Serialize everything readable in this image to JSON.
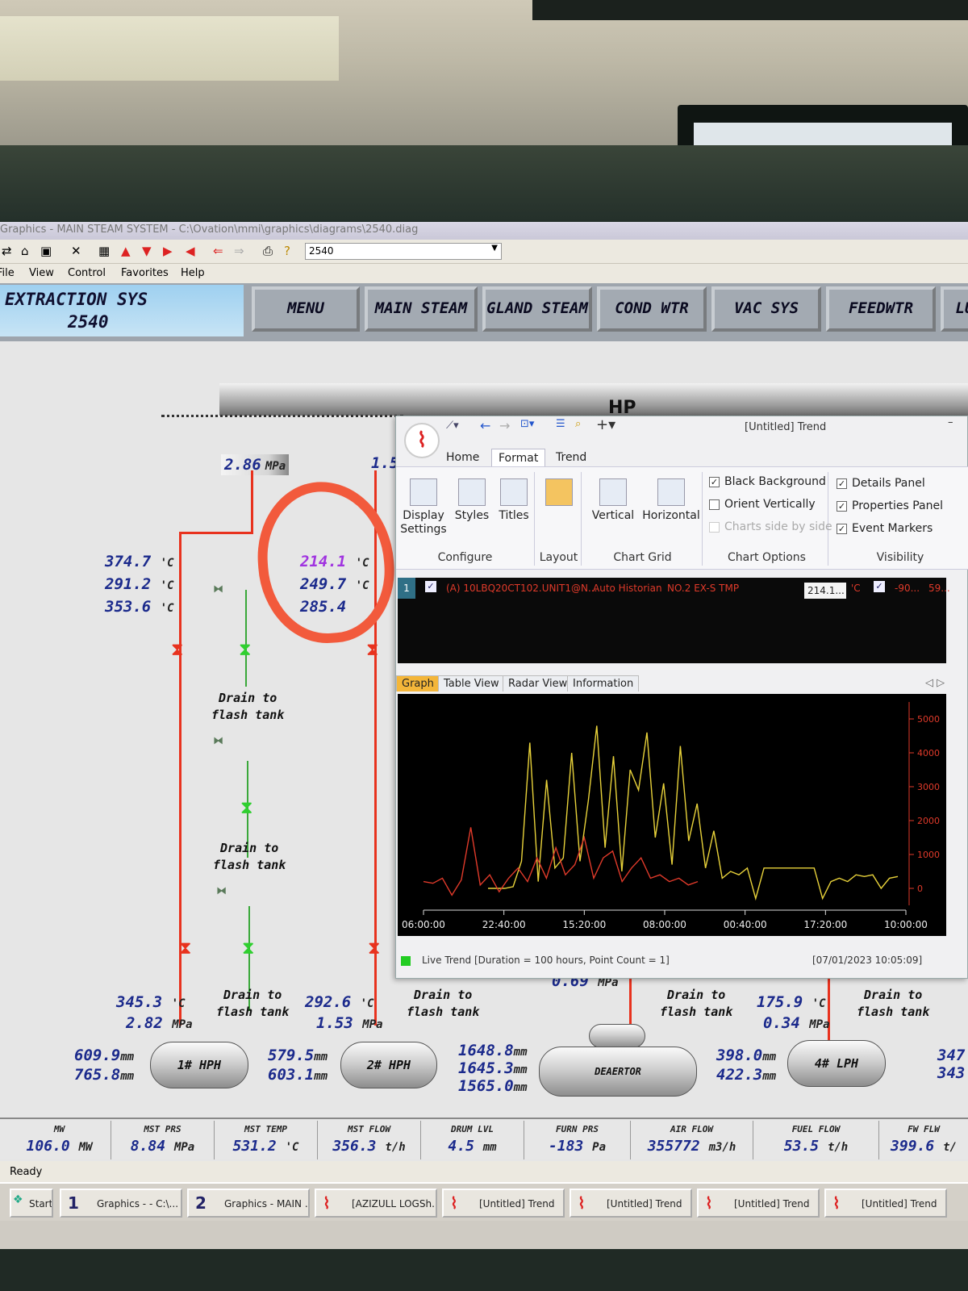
{
  "window": {
    "title": "Graphics - MAIN STEAM SYSTEM - C:\\Ovation\\mmi\\graphics\\diagrams\\2540.diag",
    "diagram_combo": "2540"
  },
  "menu": [
    "File",
    "View",
    "Control",
    "Favorites",
    "Help"
  ],
  "header": {
    "title": "EXTRACTION SYS",
    "number": "2540"
  },
  "nav": [
    "MENU",
    "MAIN STEAM",
    "GLAND STEAM",
    "COND WTR",
    "VAC SYS",
    "FEEDWTR",
    "LU"
  ],
  "diagram": {
    "hp_label": "HP",
    "extraction_pressure_1": "2.86",
    "extraction_pressure_2": "1.5",
    "unit_mpa": "MPa",
    "unit_c": "'C",
    "unit_mm": "mm",
    "temps_col1": [
      "374.7",
      "291.2",
      "353.6"
    ],
    "temps_col2": [
      "214.1",
      "249.7",
      "285.4"
    ],
    "drain_label_1": "Drain to",
    "drain_label_2": "flash tank",
    "hph1": {
      "name": "1# HPH",
      "temp": "345.3",
      "pressure": "2.82",
      "level_a": "609.9",
      "level_b": "765.8"
    },
    "hph2": {
      "name": "2# HPH",
      "temp": "292.6",
      "pressure": "1.53",
      "level_a": "579.5",
      "level_b": "603.1"
    },
    "deaerator": {
      "name": "DEAERTOR",
      "pressure": "0.69",
      "levels": [
        "1648.8",
        "1645.3",
        "1565.0"
      ]
    },
    "lph4": {
      "name": "4# LPH",
      "temp": "175.9",
      "pressure": "0.34",
      "level_a": "398.0",
      "level_b": "422.3"
    },
    "right_edge_levels": [
      "347",
      "343"
    ]
  },
  "status_bar": [
    {
      "label": "MW",
      "value": "106.0",
      "unit": "MW"
    },
    {
      "label": "MST PRS",
      "value": "8.84",
      "unit": "MPa"
    },
    {
      "label": "MST TEMP",
      "value": "531.2",
      "unit": "'C"
    },
    {
      "label": "MST FLOW",
      "value": "356.3",
      "unit": "t/h"
    },
    {
      "label": "DRUM LVL",
      "value": "4.5",
      "unit": "mm"
    },
    {
      "label": "FURN PRS",
      "value": "-183",
      "unit": "Pa"
    },
    {
      "label": "AIR FLOW",
      "value": "355772",
      "unit": "m3/h"
    },
    {
      "label": "FUEL FLOW",
      "value": "53.5",
      "unit": "t/h"
    },
    {
      "label": "FW FLW",
      "value": "399.6",
      "unit": "t/"
    }
  ],
  "ready_text": "Ready",
  "taskbar": [
    "Start",
    "Graphics - - C:\\...",
    "Graphics - MAIN ...",
    "[AZIZULL LOGSh...",
    "[Untitled] Trend",
    "[Untitled] Trend",
    "[Untitled] Trend",
    "[Untitled] Trend"
  ],
  "taskbar_numbers": [
    "1",
    "2"
  ],
  "trend": {
    "title": "[Untitled] Trend",
    "tabs": [
      "Home",
      "Format",
      "Trend"
    ],
    "active_tab": "Format",
    "ribbon": {
      "configure": {
        "group": "Configure",
        "buttons": [
          "Display Settings",
          "Styles",
          "Titles"
        ]
      },
      "layout": {
        "group": "Layout"
      },
      "chart_grid": {
        "group": "Chart Grid",
        "buttons": [
          "Vertical",
          "Horizontal"
        ]
      },
      "chart_options": {
        "group": "Chart Options",
        "options": [
          {
            "label": "Black Background",
            "checked": true,
            "enabled": true
          },
          {
            "label": "Orient Vertically",
            "checked": false,
            "enabled": true
          },
          {
            "label": "Charts side by side",
            "checked": false,
            "enabled": false
          }
        ]
      },
      "visibility": {
        "group": "Visibility",
        "options": [
          {
            "label": "Details Panel",
            "checked": true
          },
          {
            "label": "Properties Panel",
            "checked": true
          },
          {
            "label": "Event Markers",
            "checked": true
          }
        ]
      }
    },
    "pen": {
      "number": "1",
      "tag": "(A) 10LBQ20CT102.UNIT1@N...",
      "source": "Auto Historian",
      "description": "NO.2 EX-S TMP",
      "value": "214.1...",
      "unit": "'C",
      "range_low": "-90...",
      "range_high": "59..."
    },
    "graph_tabs": [
      "Graph",
      "Table View",
      "Radar View",
      "Information"
    ],
    "status_text": "Live Trend [Duration = 100 hours, Point Count = 1]",
    "timestamp": "[07/01/2023 10:05:09]"
  },
  "chart_data": {
    "type": "line",
    "x": [
      "06:00:00",
      "22:40:00",
      "15:20:00",
      "08:00:00",
      "00:40:00",
      "17:20:00",
      "10:00:00"
    ],
    "ylim": [
      -500,
      5500
    ],
    "y_ticks": [
      "0",
      "1000",
      "2000",
      "3000",
      "4000",
      "5000"
    ],
    "series": [
      {
        "color": "#e8d23a",
        "values": [
          0,
          0,
          0,
          50,
          800,
          4300,
          200,
          3200,
          600,
          900,
          4000,
          800,
          2600,
          4800,
          1200,
          3900,
          500,
          3500,
          2900,
          4600,
          1500,
          3100,
          700,
          4200,
          1400,
          2500,
          600,
          1700,
          300,
          500,
          400,
          600,
          -300,
          600,
          600,
          600,
          600,
          600,
          600,
          600,
          -300,
          200,
          300,
          200,
          400,
          350,
          400,
          0,
          300,
          350
        ]
      },
      {
        "color": "#e03a2a",
        "values": [
          200,
          150,
          300,
          -200,
          250,
          1800,
          100,
          400,
          -100,
          300,
          600,
          200,
          900,
          300,
          1200,
          400,
          700,
          1500,
          300,
          900,
          1100,
          200,
          600,
          900,
          300,
          400,
          200,
          300,
          100,
          200
        ]
      }
    ]
  }
}
